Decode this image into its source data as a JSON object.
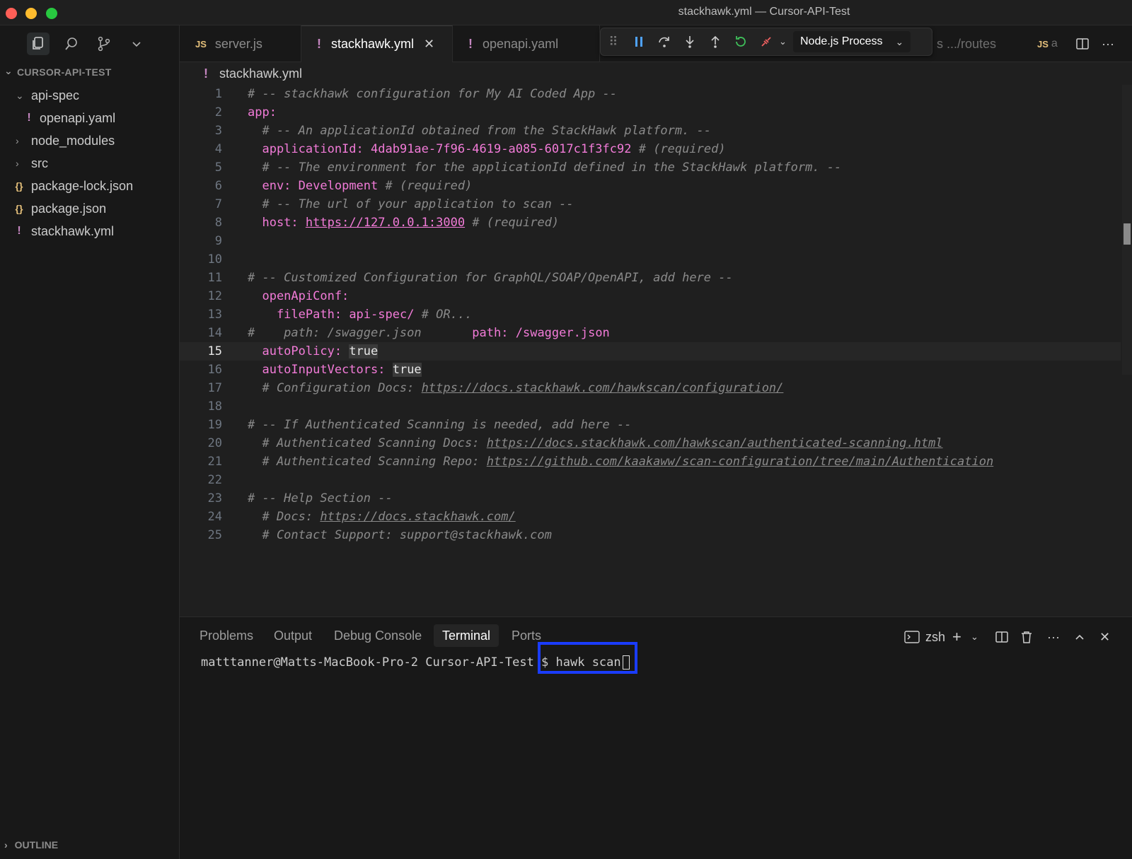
{
  "window": {
    "title": "stackhawk.yml — Cursor-API-Test"
  },
  "sidebar": {
    "root": "CURSOR-API-TEST",
    "tree": [
      {
        "label": "api-spec",
        "type": "folder-open",
        "depth": 1
      },
      {
        "label": "openapi.yaml",
        "type": "yaml",
        "depth": 2
      },
      {
        "label": "node_modules",
        "type": "folder",
        "depth": 1
      },
      {
        "label": "src",
        "type": "folder",
        "depth": 1
      },
      {
        "label": "package-lock.json",
        "type": "json",
        "depth": 1
      },
      {
        "label": "package.json",
        "type": "json",
        "depth": 1
      },
      {
        "label": "stackhawk.yml",
        "type": "yaml",
        "depth": 1
      }
    ],
    "outline": "OUTLINE"
  },
  "tabs": {
    "items": [
      {
        "label": "server.js",
        "badge": "JS"
      },
      {
        "label": "stackhawk.yml",
        "badge": "!"
      },
      {
        "label": "openapi.yaml",
        "badge": "!"
      }
    ],
    "routes_label": "s .../routes",
    "js_a_label": "a",
    "js_badge": "JS"
  },
  "debug": {
    "process_label": "Node.js Process"
  },
  "breadcrumb": {
    "file": "stackhawk.yml"
  },
  "editor": {
    "current_line": 15,
    "lines": [
      "1",
      "2",
      "3",
      "4",
      "5",
      "6",
      "7",
      "8",
      "9",
      "10",
      "11",
      "12",
      "13",
      "14",
      "15",
      "16",
      "17",
      "18",
      "19",
      "20",
      "21",
      "22",
      "23",
      "24",
      "25"
    ],
    "text": {
      "l1": "# -- stackhawk configuration for My AI Coded App --",
      "l2": "app:",
      "l3": "  # -- An applicationId obtained from the StackHawk platform. --",
      "l4_key": "  applicationId:",
      "l4_val": "4dab91ae-7f96-4619-a085-6017c1f3fc92",
      "l4_cm": "# (required)",
      "l5": "  # -- The environment for the applicationId defined in the StackHawk platform. --",
      "l6_key": "  env:",
      "l6_val": "Development",
      "l6_cm": "# (required)",
      "l7": "  # -- The url of your application to scan --",
      "l8_key": "  host:",
      "l8_val": "https://127.0.0.1:3000",
      "l8_cm": "# (required)",
      "l11": "# -- Customized Configuration for GraphQL/SOAP/OpenAPI, add here --",
      "l12_key": "  openApiConf:",
      "l13_key": "    filePath:",
      "l13_val": "api-spec/",
      "l13_cm": "# OR...",
      "l14_cm": "#    path: /swagger.json",
      "l14_key": "path:",
      "l14_val": "/swagger.json",
      "l15_key": "  autoPolicy:",
      "l15_val": "true",
      "l16_key": "  autoInputVectors:",
      "l16_val": "true",
      "l17_cm": "  # Configuration Docs:",
      "l17_url": "https://docs.stackhawk.com/hawkscan/configuration/",
      "l19": "# -- If Authenticated Scanning is needed, add here --",
      "l20_cm": "  # Authenticated Scanning Docs:",
      "l20_url": "https://docs.stackhawk.com/hawkscan/authenticated-scanning.html",
      "l21_cm": "  # Authenticated Scanning Repo:",
      "l21_url": "https://github.com/kaakaww/scan-configuration/tree/main/Authentication",
      "l23": "# -- Help Section --",
      "l24_cm": "  # Docs:",
      "l24_url": "https://docs.stackhawk.com/",
      "l25": "  # Contact Support: support@stackhawk.com"
    }
  },
  "panel": {
    "tabs": [
      "Problems",
      "Output",
      "Debug Console",
      "Terminal",
      "Ports"
    ],
    "active_tab": "Terminal",
    "shell": "zsh",
    "prompt": "matttanner@Matts-MacBook-Pro-2 Cursor-API-Test $ ",
    "command": "hawk scan"
  },
  "colors": {
    "highlight_box": "#1a3cff",
    "accent_key": "#f27bd8"
  }
}
